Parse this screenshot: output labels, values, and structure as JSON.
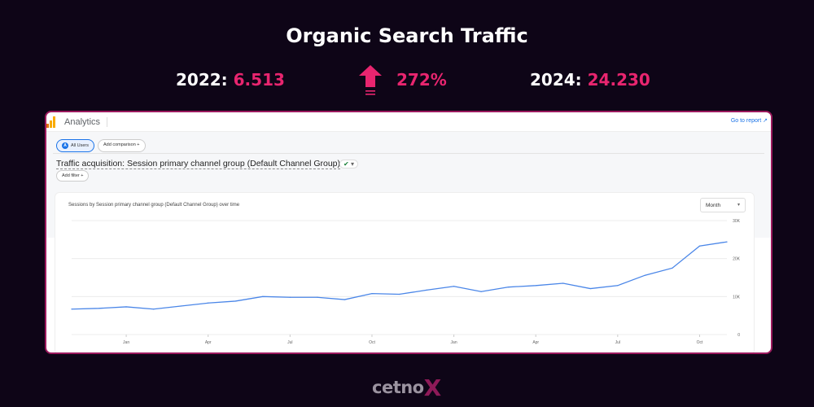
{
  "header": {
    "title": "Organic Search Traffic",
    "stat_2022_label": "2022:",
    "stat_2022_value": "6.513",
    "growth": "272%",
    "stat_2024_label": "2024:",
    "stat_2024_value": "24.230",
    "accent": "#e8256f"
  },
  "analytics": {
    "app_name": "Analytics",
    "go_to_report": "Go to report",
    "segment_chip": "All Users",
    "segment_avatar": "A",
    "add_comparison": "Add comparison +",
    "report_title": "Traffic acquisition: Session primary channel group (Default Channel Group)",
    "status_icon": "check-circle-icon",
    "add_filter": "Add filter +",
    "chart_title": "Sessions by Session primary channel group (Default Channel Group) over time",
    "granularity": "Month"
  },
  "chart_data": {
    "type": "line",
    "title": "Sessions by Session primary channel group (Default Channel Group) over time",
    "xlabel": "",
    "ylabel": "",
    "x_tick_labels": [
      "Jan",
      "Apr",
      "Jul",
      "Oct",
      "Jan",
      "Apr",
      "Jul",
      "Oct"
    ],
    "y_tick_labels": [
      "0",
      "10K",
      "20K",
      "30K"
    ],
    "ylim": [
      0,
      30000
    ],
    "grid": true,
    "series": [
      {
        "name": "Sessions",
        "color": "#4a86e8",
        "values": [
          6700,
          6900,
          7300,
          6700,
          7500,
          8300,
          8800,
          10000,
          9800,
          9800,
          9200,
          10800,
          10600,
          11700,
          12700,
          11300,
          12500,
          12900,
          13500,
          12100,
          12900,
          15600,
          17500,
          23300,
          24400
        ]
      }
    ]
  },
  "footer": {
    "brand_main": "cetno",
    "brand_x": "X"
  }
}
